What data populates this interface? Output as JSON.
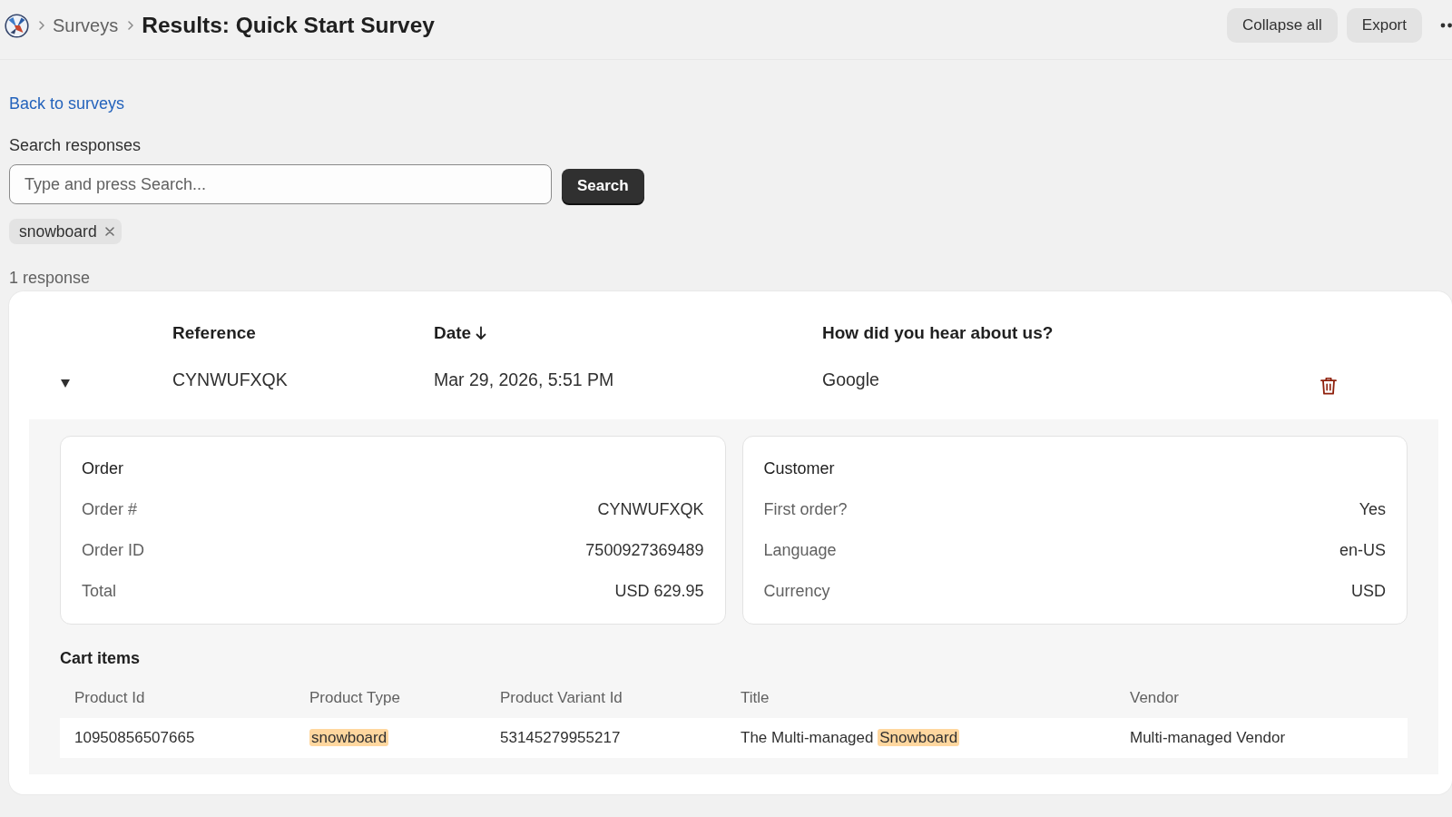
{
  "header": {
    "breadcrumbs": [
      {
        "label": "Surveys"
      }
    ],
    "title": "Results: Quick Start Survey",
    "actions": [
      "Collapse all",
      "Export"
    ]
  },
  "back_link": "Back to surveys",
  "search": {
    "label": "Search responses",
    "placeholder": "Type and press Search...",
    "button": "Search"
  },
  "filters": [
    {
      "label": "snowboard"
    }
  ],
  "result_count": "1 response",
  "responses_table": {
    "columns": [
      {
        "label": "Reference",
        "sorted": false
      },
      {
        "label": "Date",
        "sorted": true
      },
      {
        "label": "How did you hear about us?",
        "sorted": false
      }
    ],
    "rows": [
      {
        "cells": [
          "CYNWUFXQK",
          "Mar 29, 2026, 5:51 PM",
          "Google"
        ],
        "expanded": true,
        "details": {
          "cards": [
            {
              "title": "Order",
              "fields": [
                {
                  "label": "Order #",
                  "value": "CYNWUFXQK"
                },
                {
                  "label": "Order ID",
                  "value": "7500927369489"
                },
                {
                  "label": "Total",
                  "value": "USD 629.95"
                }
              ]
            },
            {
              "title": "Customer",
              "fields": [
                {
                  "label": "First order?",
                  "value": "Yes"
                },
                {
                  "label": "Language",
                  "value": "en-US"
                },
                {
                  "label": "Currency",
                  "value": "USD"
                }
              ]
            }
          ],
          "cart": {
            "title": "Cart items",
            "columns": [
              "Product Id",
              "Product Type",
              "Product Variant Id",
              "Title",
              "Vendor"
            ],
            "rows": [
              {
                "cells": [
                  [
                    {
                      "text": "10950856507665",
                      "highlighted": false
                    }
                  ],
                  [
                    {
                      "text": "snowboard",
                      "highlighted": true
                    }
                  ],
                  [
                    {
                      "text": "53145279955217",
                      "highlighted": false
                    }
                  ],
                  [
                    {
                      "text": "The Multi-managed ",
                      "highlighted": false
                    },
                    {
                      "text": "Snowboard",
                      "highlighted": true
                    }
                  ],
                  [
                    {
                      "text": "Multi-managed Vendor",
                      "highlighted": false
                    }
                  ]
                ]
              }
            ]
          }
        }
      }
    ]
  }
}
